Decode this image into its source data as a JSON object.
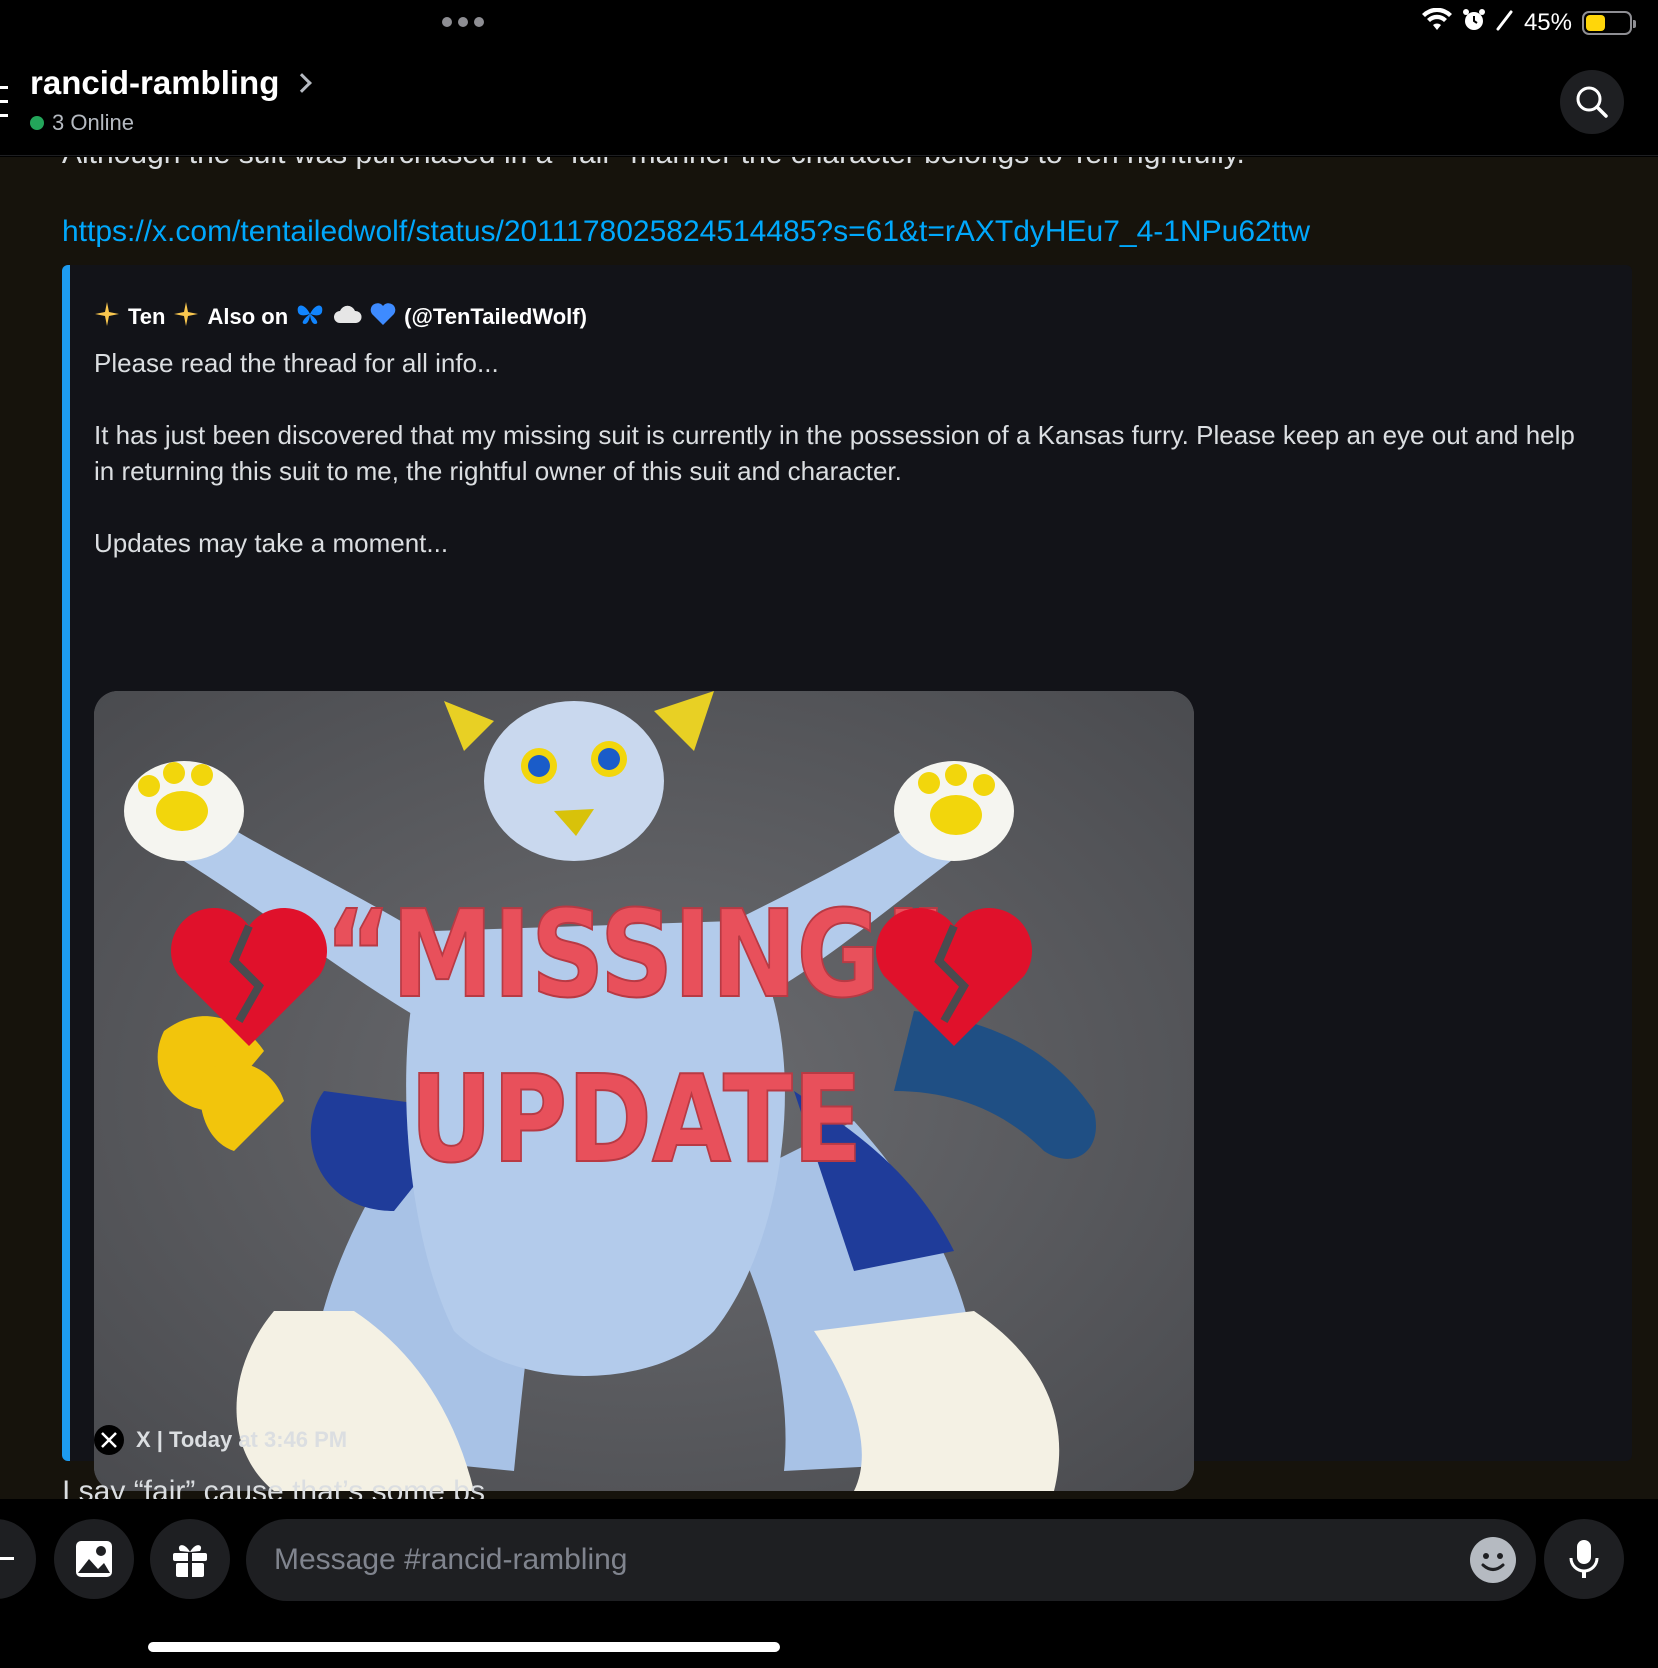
{
  "status_bar": {
    "battery_percent": "45%",
    "battery_level": 0.45,
    "battery_color": "#ffd60a"
  },
  "header": {
    "channel_name": "rancid-rambling",
    "online_text": "3 Online",
    "online_color": "#23a55a"
  },
  "messages": {
    "clipped_line": "Although the suit was purchased in a “fair” manner the character belongs to Ten rightfully.",
    "link": "https://x.com/tentailedwolf/status/2011178025824514485?s=61&t=rAXTdyHEu7_4-1NPu62ttw",
    "embed": {
      "accent_color": "#1d9bf0",
      "author": "✨ Ten ✨ Also on 🦋☁️💙 (@TenTailedWolf)",
      "author_parts": {
        "name": "Ten",
        "also_on": "Also on",
        "handle": "(@TenTailedWolf)"
      },
      "description": [
        "Please read the thread for all info...",
        "",
        "It has just been discovered that my missing suit is currently in the possession of a Kansas furry. Please keep an eye out and help in returning this suit to me, the rightful owner of this suit and character.",
        "",
        "Updates may take a moment..."
      ],
      "image_overlay": {
        "line1": "“MISSING”",
        "line2": "UPDATE",
        "color": "#e8505b"
      },
      "footer": "X | Today at 3:46 PM"
    },
    "next_message": "I say “fair” cause that’s some bs"
  },
  "composer": {
    "placeholder": "Message #rancid-rambling"
  },
  "icons": {
    "wifi": "wifi-icon",
    "alarm": "alarm-icon",
    "pencil": "pencil-icon",
    "battery": "battery-icon",
    "search": "search-icon",
    "image": "image-icon",
    "gift": "gift-icon",
    "emoji": "emoji-icon",
    "mic": "microphone-icon",
    "x": "x-logo-icon"
  }
}
